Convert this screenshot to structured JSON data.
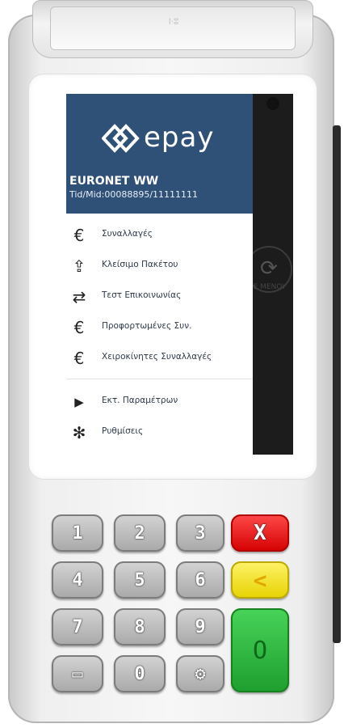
{
  "device": {
    "embossed_brand": "ⵏ⋅ⵓ"
  },
  "drawer": {
    "logo_text": "epay",
    "company": "EURONET WW",
    "tid_mid": "Tid/Mid:00088895/11111111",
    "items": [
      {
        "label": "Συναλλαγές",
        "icon": "euro-icon",
        "glyph": "€"
      },
      {
        "label": "Κλείσιμο Πακέτου",
        "icon": "folder-upload-icon",
        "glyph": "⇪"
      },
      {
        "label": "Τεστ Επικοινωνίας",
        "icon": "arrows-exchange-icon",
        "glyph": "⇄"
      },
      {
        "label": "Προφορτωμένες Συν.",
        "icon": "euro-icon",
        "glyph": "€"
      },
      {
        "label": "Χειροκίνητες Συναλλαγές",
        "icon": "euro-icon",
        "glyph": "€"
      },
      {
        "label": "Εκτ. Παραμέτρων",
        "icon": "play-arrow-icon",
        "glyph": "▶"
      },
      {
        "label": "Ρυθμίσεις",
        "icon": "gear-icon",
        "glyph": "✻"
      }
    ]
  },
  "background_screen": {
    "menu_label": "E MENOY",
    "menu_icon": "settings-cycle-icon"
  },
  "keypad": {
    "keys": [
      {
        "label": "1",
        "name": "key-1"
      },
      {
        "label": "2",
        "name": "key-2"
      },
      {
        "label": "3",
        "name": "key-3"
      },
      {
        "label": "X",
        "name": "key-cancel"
      },
      {
        "label": "4",
        "name": "key-4"
      },
      {
        "label": "5",
        "name": "key-5"
      },
      {
        "label": "6",
        "name": "key-6"
      },
      {
        "label": "<",
        "name": "key-clear"
      },
      {
        "label": "7",
        "name": "key-7"
      },
      {
        "label": "8",
        "name": "key-8"
      },
      {
        "label": "9",
        "name": "key-9"
      },
      {
        "label": "O",
        "name": "key-enter"
      },
      {
        "label": "▭",
        "name": "key-function"
      },
      {
        "label": "0",
        "name": "key-0"
      },
      {
        "label": "⚙",
        "name": "key-settings"
      }
    ],
    "colors": {
      "cancel": "#e60000",
      "clear": "#f2e200",
      "enter": "#22aa33"
    }
  },
  "theme": {
    "drawer_header": "#2f5177"
  }
}
